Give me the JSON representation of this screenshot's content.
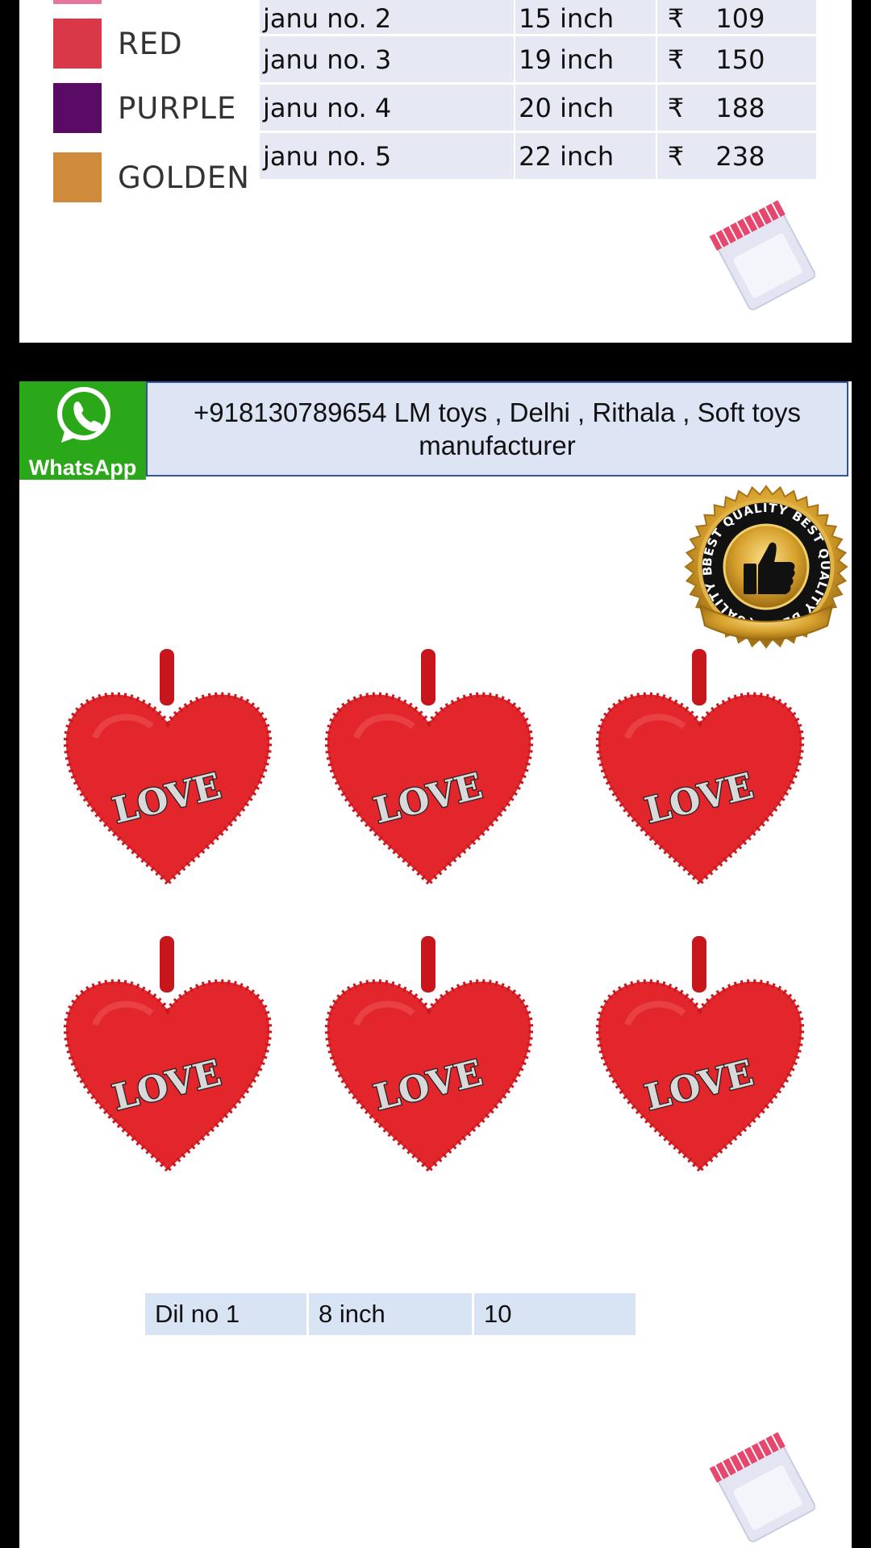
{
  "colors": [
    {
      "label": "RED",
      "hex": "#d83847"
    },
    {
      "label": "PURPLE",
      "hex": "#5a0b63"
    },
    {
      "label": "GOLDEN",
      "hex": "#d08a3c"
    }
  ],
  "top_swatch_hex": "#e8739c",
  "price_table": [
    {
      "name": "janu no. 2",
      "size": "15 inch",
      "currency": "₹",
      "price": "109"
    },
    {
      "name": "janu no. 3",
      "size": "19 inch",
      "currency": "₹",
      "price": "150"
    },
    {
      "name": "janu no. 4",
      "size": "20 inch",
      "currency": "₹",
      "price": "188"
    },
    {
      "name": "janu no. 5",
      "size": "22 inch",
      "currency": "₹",
      "price": "238"
    }
  ],
  "whatsapp": {
    "label": "WhatsApp",
    "contact": "+918130789654 LM toys , Delhi , Rithala , Soft toys manufacturer"
  },
  "badge": {
    "text": "BEST QUALITY BEST QUALITY BEST QUALITY BEST QUALITY",
    "icon": "thumbs-up-icon"
  },
  "product": {
    "heart_text": "LOVE",
    "heart_count": 6,
    "row": {
      "name": "Dil no 1",
      "size": "8 inch",
      "price": "10"
    }
  }
}
